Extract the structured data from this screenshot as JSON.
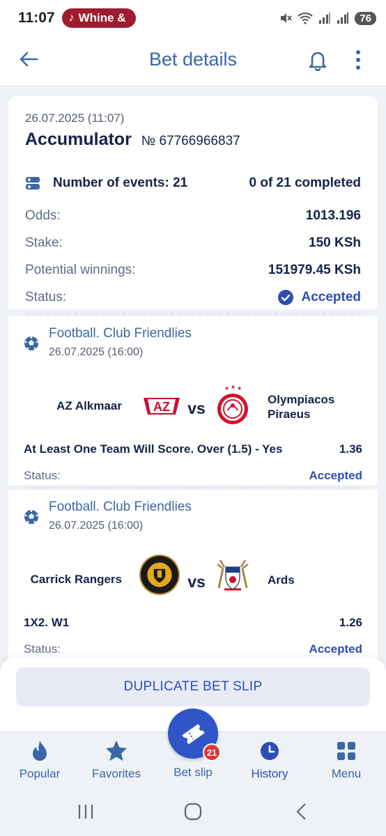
{
  "status_bar": {
    "time": "11:07",
    "media_label": "Whine &",
    "battery": "76"
  },
  "header": {
    "title": "Bet details",
    "icons": [
      "back-arrow-icon",
      "bell-icon",
      "more-vert-icon"
    ]
  },
  "bet": {
    "datetime": "26.07.2025 (11:07)",
    "type": "Accumulator",
    "number_label": "№ 67766966837",
    "events_label": "Number of events: 21",
    "completed": "0 of 21 completed",
    "odds_label": "Odds:",
    "odds": "1013.196",
    "stake_label": "Stake:",
    "stake": "150 KSh",
    "winnings_label": "Potential winnings:",
    "winnings": "151979.45 KSh",
    "status_label": "Status:",
    "status": "Accepted"
  },
  "events": [
    {
      "league": "Football. Club Friendlies",
      "datetime": "26.07.2025 (16:00)",
      "team1": "AZ Alkmaar",
      "team2_line1": "Olympiacos",
      "team2_line2": "Piraeus",
      "vs": "vs",
      "market": "At Least One Team Will Score. Over (1.5) - Yes",
      "odds": "1.36",
      "status_label": "Status:",
      "status": "Accepted"
    },
    {
      "league": "Football. Club Friendlies",
      "datetime": "26.07.2025 (16:00)",
      "team1": "Carrick Rangers",
      "team2_line1": "Ards",
      "vs": "vs",
      "market": "1X2. W1",
      "odds": "1.26",
      "status_label": "Status:",
      "status": "Accepted"
    }
  ],
  "actions": {
    "duplicate": "DUPLICATE BET SLIP"
  },
  "bottom_nav": {
    "popular": "Popular",
    "favorites": "Favorites",
    "bet_slip": "Bet slip",
    "bet_slip_count": "21",
    "history": "History",
    "menu": "Menu"
  },
  "colors": {
    "accent": "#2e4db5",
    "title_blue": "#3a67a5",
    "badge_red": "#e03434",
    "media_pill": "#a01b2e"
  }
}
